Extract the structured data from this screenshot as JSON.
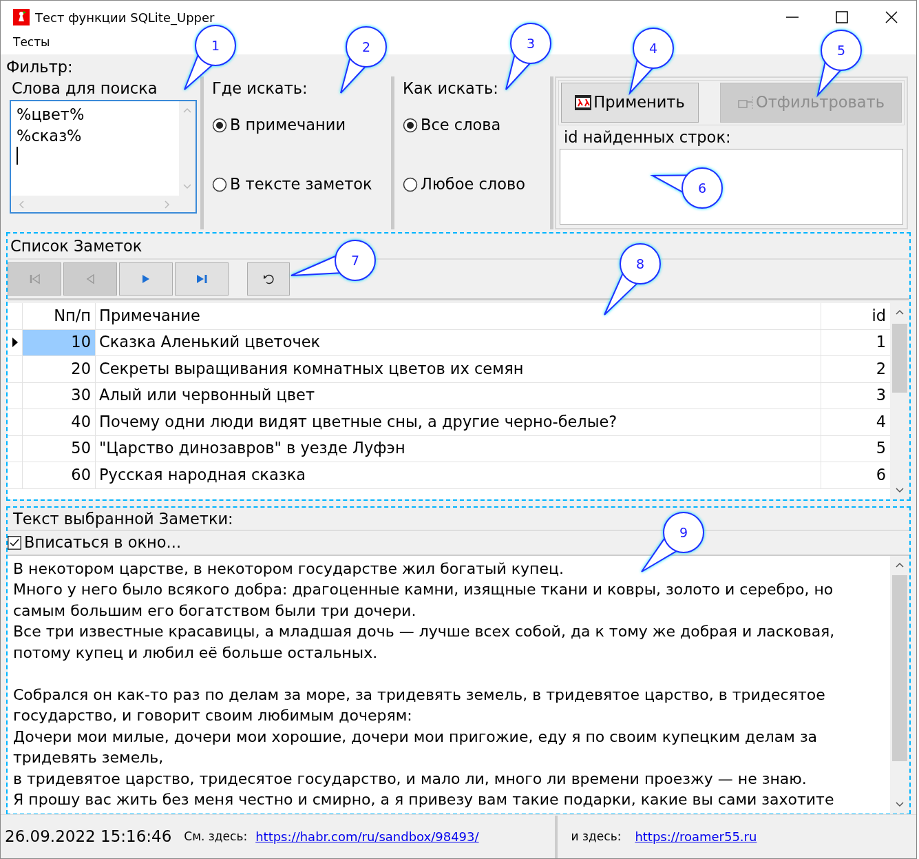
{
  "window": {
    "title": "Тест функции SQLite_Upper"
  },
  "menu": [
    {
      "label": "Тесты"
    }
  ],
  "filter": {
    "title": "Фильтр:",
    "search_words": {
      "title": "Слова для поиска",
      "lines": [
        "%цвет%",
        "%сказ%"
      ]
    },
    "where": {
      "title": "Где искать:",
      "options": [
        {
          "label": "В примечании",
          "selected": true
        },
        {
          "label": "В тексте заметок",
          "selected": false
        }
      ]
    },
    "how": {
      "title": "Как искать:",
      "options": [
        {
          "label": "Все слова",
          "selected": true
        },
        {
          "label": "Любое слово",
          "selected": false
        }
      ]
    },
    "buttons": [
      {
        "kind": "apply",
        "label": "Применить",
        "disabled": false
      },
      {
        "kind": "filter",
        "label": "Отфильтровать",
        "disabled": true
      }
    ],
    "found_ids": {
      "title": "id найденных строк:"
    }
  },
  "notes": {
    "title": "Список Заметок",
    "nav": [
      {
        "kind": "first",
        "disabled": true
      },
      {
        "kind": "prev",
        "disabled": true
      },
      {
        "kind": "next",
        "disabled": false
      },
      {
        "kind": "last",
        "disabled": false
      },
      {
        "kind": "refresh",
        "disabled": false
      }
    ],
    "columns": [
      "Nп/п",
      "Примечание",
      "id"
    ],
    "rows": [
      {
        "num": "10",
        "note": "Сказка Аленький цветочек",
        "id": "1",
        "selected": true
      },
      {
        "num": "20",
        "note": "Секреты выращивания комнатных цветов их семян",
        "id": "2",
        "selected": false
      },
      {
        "num": "30",
        "note": "Алый или червонный цвет",
        "id": "3",
        "selected": false
      },
      {
        "num": "40",
        "note": "Почему одни люди видят цветные сны, а другие черно-белые?",
        "id": "4",
        "selected": false
      },
      {
        "num": "50",
        "note": "\"Царство динозавров\" в уезде Луфэн",
        "id": "5",
        "selected": false
      },
      {
        "num": "60",
        "note": "Русская народная сказка",
        "id": "6",
        "selected": false
      }
    ]
  },
  "text_panel": {
    "title": "Текст выбранной Заметки:",
    "fit": {
      "label": "Вписаться в окно...",
      "checked": true
    },
    "paragraphs": [
      {
        "lines": [
          "В некотором царстве, в некотором государстве жил богатый купец.",
          "Много у него было всякого добра: драгоценные камни, изящные ткани и ковры, золото и серебро, но",
          "самым большим его богатством были три дочери.",
          "Все три известные красавицы, а младшая дочь — лучше всех собой, да к тому же добрая и ласковая,",
          "потому купец и любил её больше остальных."
        ]
      },
      {
        "lines": [
          "Собрался он как-то раз по делам за море, за тридевять земель, в тридевятое царство, в тридесятое",
          "государство, и говорит своим любимым дочерям:",
          "Дочери мои милые, дочери мои хорошие, дочери мои пригожие, еду я по своим купецким делам за",
          "тридевять земель,",
          "в тридевятое царство, тридесятое государство, и мало ли, много ли времени проезжу — не знаю.",
          "Я прошу вас жить без меня честно и смирно, а я привезу вам такие подарки, какие вы сами захотите"
        ]
      }
    ]
  },
  "status": {
    "datetime": "26.09.2022 15:16:46",
    "label_1": "См. здесь:",
    "link_1": "https://habr.com/ru/sandbox/98493/",
    "label_2": "и здесь:",
    "link_2": "https://roamer55.ru"
  },
  "callouts": [
    {
      "number": "1"
    },
    {
      "number": "2"
    },
    {
      "number": "3"
    },
    {
      "number": "4"
    },
    {
      "number": "5"
    },
    {
      "number": "6"
    },
    {
      "number": "7"
    },
    {
      "number": "8"
    },
    {
      "number": "9"
    }
  ]
}
